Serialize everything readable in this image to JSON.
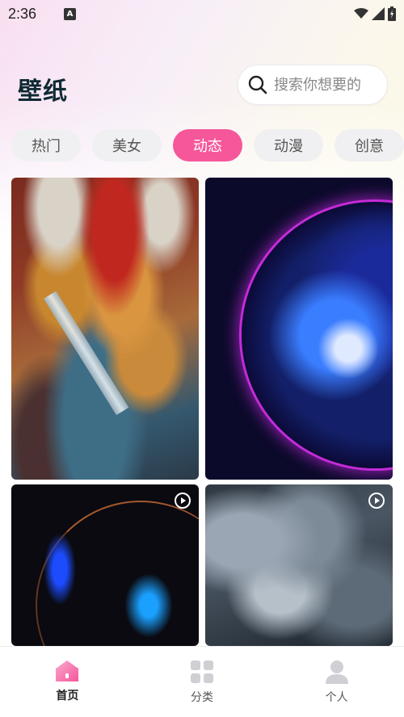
{
  "status_bar": {
    "time": "2:36",
    "notification_badge": "A"
  },
  "header": {
    "title": "壁纸"
  },
  "search": {
    "placeholder": "搜索你想要的",
    "icon": "search-icon"
  },
  "tabs": [
    {
      "label": "热门",
      "active": false
    },
    {
      "label": "美女",
      "active": false
    },
    {
      "label": "动态",
      "active": true
    },
    {
      "label": "动漫",
      "active": false
    },
    {
      "label": "创意",
      "active": false
    }
  ],
  "wallpapers": [
    {
      "name": "dragon-art-wallpaper",
      "has_play": false
    },
    {
      "name": "glowing-planet-wallpaper",
      "has_play": false
    },
    {
      "name": "dark-abstract-wallpaper",
      "has_play": true
    },
    {
      "name": "clouds-wallpaper",
      "has_play": true
    }
  ],
  "bottom_nav": {
    "items": [
      {
        "label": "首页",
        "icon": "home-icon",
        "active": true
      },
      {
        "label": "分类",
        "icon": "grid-icon",
        "active": false
      },
      {
        "label": "个人",
        "icon": "user-icon",
        "active": false
      }
    ]
  },
  "colors": {
    "accent": "#f5579a",
    "title": "#0f2a33",
    "tab_bg": "#f0f0f2",
    "nav_icon": "#cfcfd4"
  }
}
